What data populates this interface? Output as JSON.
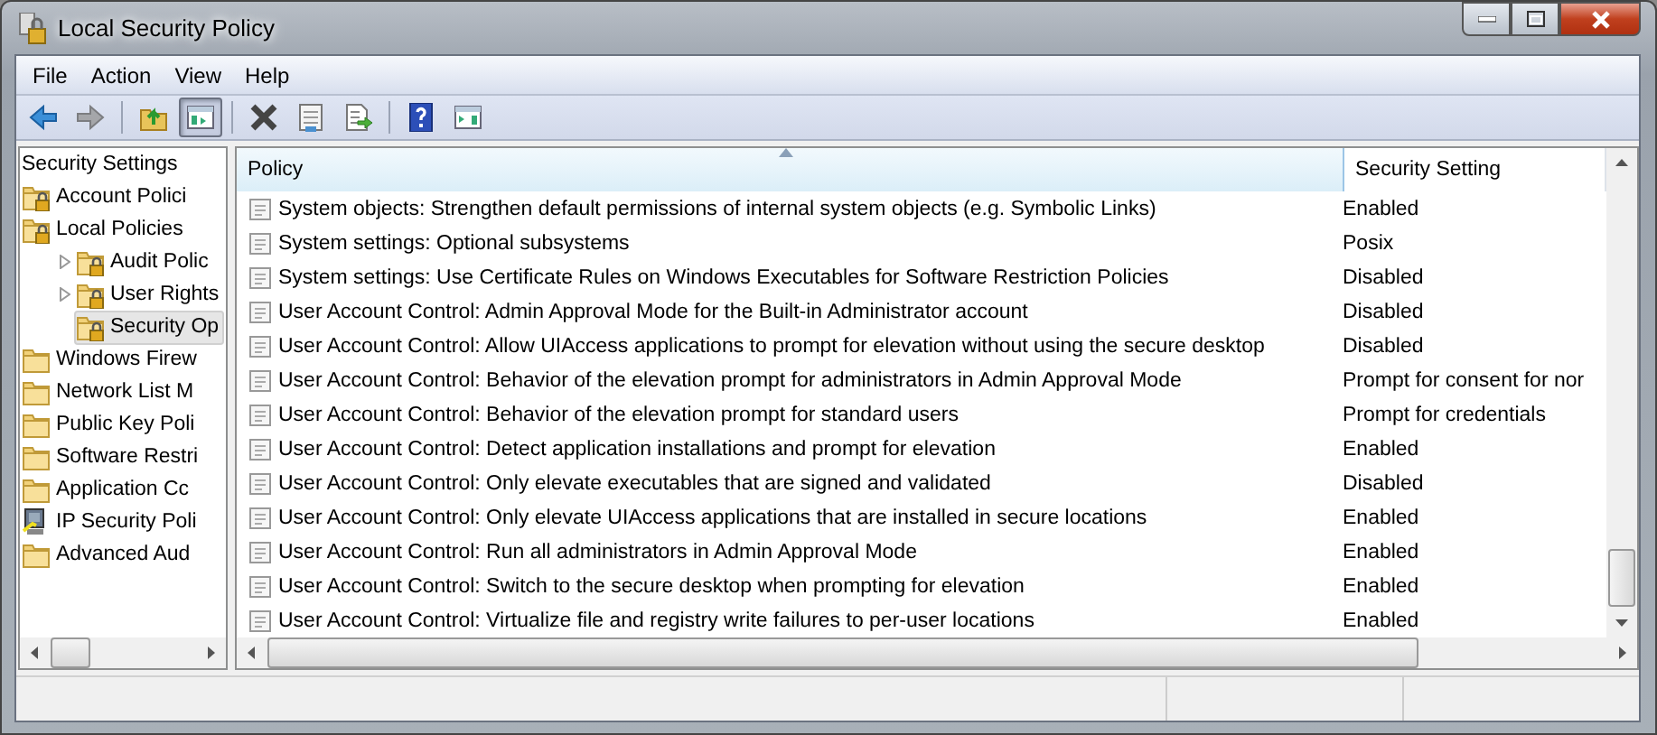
{
  "window": {
    "title": "Local Security Policy"
  },
  "menu": [
    "File",
    "Action",
    "View",
    "Help"
  ],
  "toolbar": [
    {
      "kind": "back",
      "disabled": false,
      "pressed": false
    },
    {
      "kind": "forward",
      "disabled": true,
      "pressed": false
    },
    {
      "kind": "sep"
    },
    {
      "kind": "up",
      "disabled": false,
      "pressed": false
    },
    {
      "kind": "tree",
      "disabled": false,
      "pressed": true
    },
    {
      "kind": "sep"
    },
    {
      "kind": "delete",
      "disabled": false,
      "pressed": false
    },
    {
      "kind": "properties",
      "disabled": false,
      "pressed": false
    },
    {
      "kind": "export",
      "disabled": false,
      "pressed": false
    },
    {
      "kind": "sep"
    },
    {
      "kind": "help",
      "disabled": false,
      "pressed": false
    },
    {
      "kind": "pane",
      "disabled": false,
      "pressed": false
    }
  ],
  "tree": {
    "root": "Security Settings",
    "items": [
      {
        "label": "Account Polici",
        "kind": "lock",
        "selected": false
      },
      {
        "label": "Local Policies",
        "kind": "lock",
        "selected": false,
        "children": [
          {
            "label": "Audit Polic",
            "kind": "lock",
            "selected": false,
            "expanded": false
          },
          {
            "label": "User Rights",
            "kind": "lock",
            "selected": false,
            "expanded": false
          },
          {
            "label": "Security Op",
            "kind": "lock",
            "selected": true
          }
        ]
      },
      {
        "label": "Windows Firew",
        "kind": "folder",
        "selected": false
      },
      {
        "label": "Network List M",
        "kind": "folder",
        "selected": false
      },
      {
        "label": "Public Key Poli",
        "kind": "folder",
        "selected": false
      },
      {
        "label": "Software Restri",
        "kind": "folder",
        "selected": false
      },
      {
        "label": "Application Cc",
        "kind": "folder",
        "selected": false
      },
      {
        "label": "IP Security Poli",
        "kind": "ip",
        "selected": false
      },
      {
        "label": "Advanced Aud",
        "kind": "folder",
        "selected": false
      }
    ]
  },
  "table": {
    "columns": [
      "Policy",
      "Security Setting"
    ],
    "rows": [
      [
        "System objects: Strengthen default permissions of internal system objects (e.g. Symbolic Links)",
        "Enabled"
      ],
      [
        "System settings: Optional subsystems",
        "Posix"
      ],
      [
        "System settings: Use Certificate Rules on Windows Executables for Software Restriction Policies",
        "Disabled"
      ],
      [
        "User Account Control: Admin Approval Mode for the Built-in Administrator account",
        "Disabled"
      ],
      [
        "User Account Control: Allow UIAccess applications to prompt for elevation without using the secure desktop",
        "Disabled"
      ],
      [
        "User Account Control: Behavior of the elevation prompt for administrators in Admin Approval Mode",
        "Prompt for consent for nor"
      ],
      [
        "User Account Control: Behavior of the elevation prompt for standard users",
        "Prompt for credentials"
      ],
      [
        "User Account Control: Detect application installations and prompt for elevation",
        "Enabled"
      ],
      [
        "User Account Control: Only elevate executables that are signed and validated",
        "Disabled"
      ],
      [
        "User Account Control: Only elevate UIAccess applications that are installed in secure locations",
        "Enabled"
      ],
      [
        "User Account Control: Run all administrators in Admin Approval Mode",
        "Enabled"
      ],
      [
        "User Account Control: Switch to the secure desktop when prompting for elevation",
        "Enabled"
      ],
      [
        "User Account Control: Virtualize file and registry write failures to per-user locations",
        "Enabled"
      ]
    ]
  }
}
